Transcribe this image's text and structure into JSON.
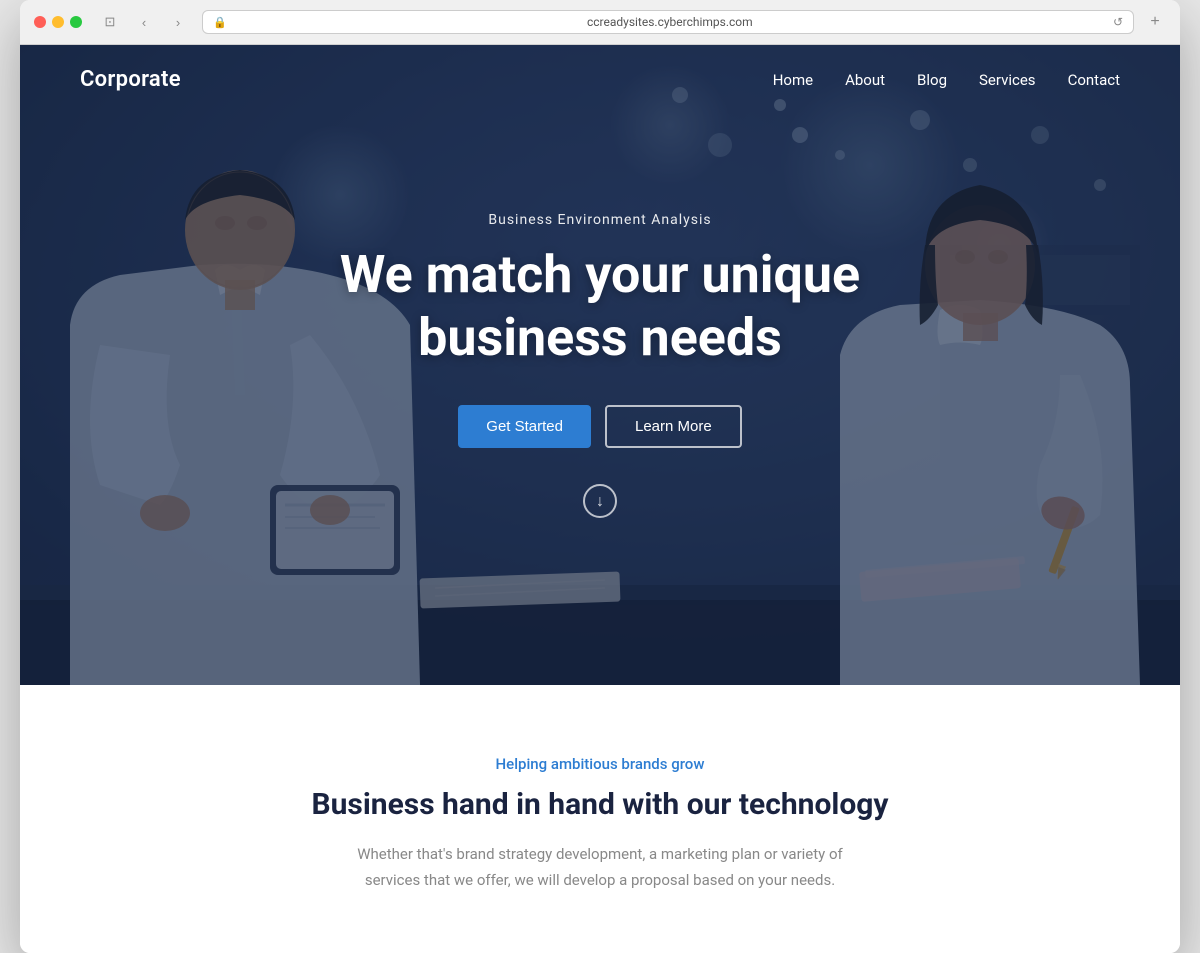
{
  "browser": {
    "url": "ccreadysites.cyberchimps.com",
    "back_btn": "‹",
    "forward_btn": "›"
  },
  "site": {
    "logo": "Corporate",
    "nav": {
      "items": [
        {
          "label": "Home",
          "id": "home"
        },
        {
          "label": "About",
          "id": "about"
        },
        {
          "label": "Blog",
          "id": "blog"
        },
        {
          "label": "Services",
          "id": "services"
        },
        {
          "label": "Contact",
          "id": "contact"
        }
      ]
    },
    "hero": {
      "tagline": "Business Environment Analysis",
      "title_line1": "We match your unique",
      "title_line2": "business needs",
      "btn_primary": "Get Started",
      "btn_secondary": "Learn More"
    },
    "below_fold": {
      "eyebrow": "Helping ambitious brands grow",
      "title": "Business hand in hand with our technology",
      "description": "Whether that's brand strategy development, a marketing plan or variety of services that we offer, we will develop a proposal based on your needs."
    }
  }
}
